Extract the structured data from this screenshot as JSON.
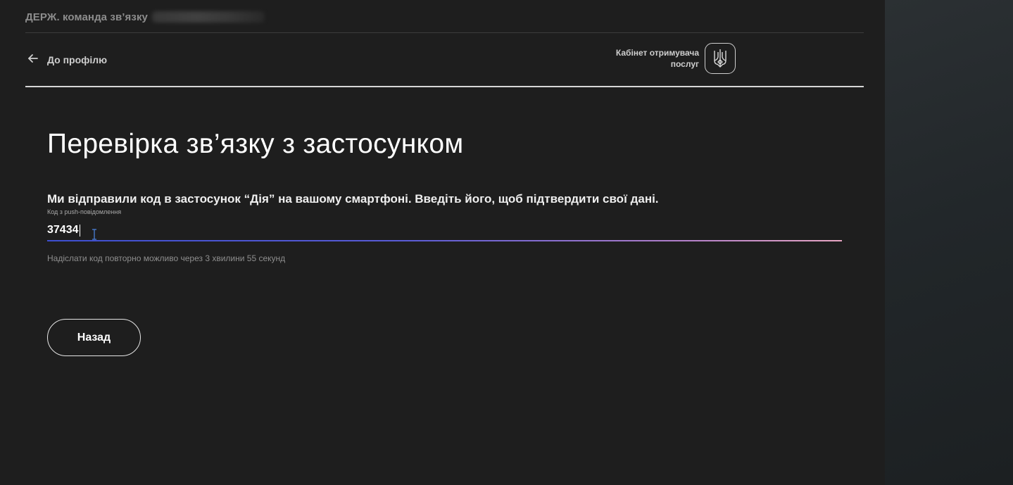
{
  "header": {
    "org_title": "ДЕРЖ. команда зв’язку",
    "back_link_label": "До профілю",
    "cabinet_line1": "Кабінет отримувача",
    "cabinet_line2": "послуг",
    "emblem_icon": "trident-icon",
    "back_icon": "arrow-left-icon"
  },
  "main": {
    "title": "Перевірка зв’язку з застосунком",
    "instruction": "Ми відправили код в застосунок “Дія” на вашому смартфоні. Введіть його, щоб підтвердити свої дані.",
    "code_field": {
      "label": "Код з push-повідомлення",
      "value": "37434"
    },
    "resend_note": "Надіслати код повторно можливо через 3 хвилини 55 секунд",
    "back_button_label": "Назад"
  },
  "colors": {
    "background": "#1e1e1e",
    "side_panel": "#262b2e",
    "underline_start": "#3d4fd0",
    "underline_end": "#e8a7c4"
  }
}
